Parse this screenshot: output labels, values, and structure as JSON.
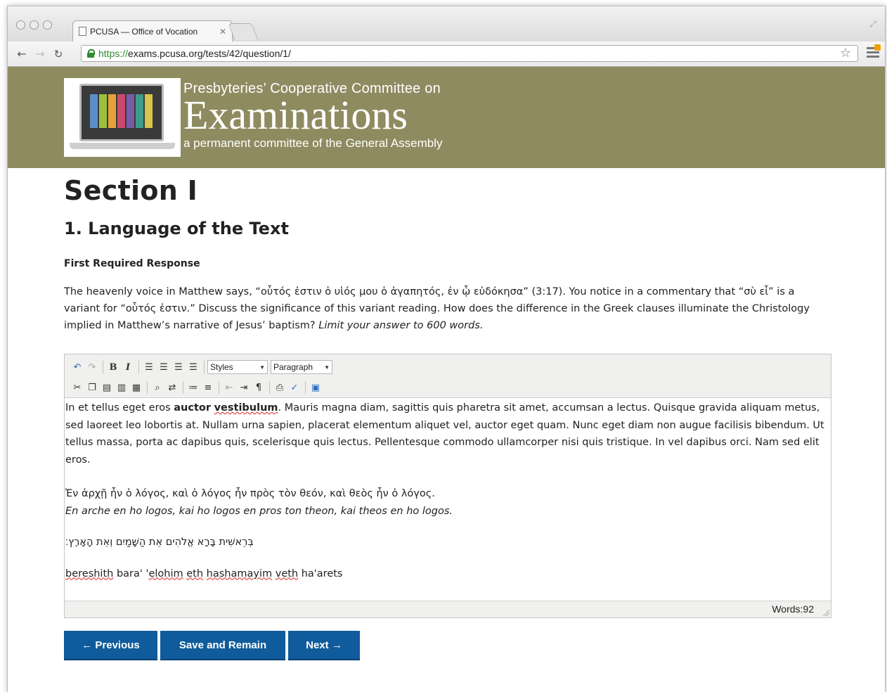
{
  "browser": {
    "tab_title": "PCUSA — Office of Vocation",
    "url_scheme": "https://",
    "url_rest": "exams.pcusa.org/tests/42/question/1/"
  },
  "banner": {
    "line1": "Presbyteries’ Cooperative Committee on",
    "title": "Examinations",
    "line3": "a permanent committee of the General Assembly",
    "color": "#8f8b60"
  },
  "section": {
    "heading": "Section I",
    "subheading": "1. Language of the Text",
    "required_label": "First Required Response",
    "prompt": "The heavenly voice in Matthew says, “οὗτός ἐστιν ὁ υἱός μου ὁ ἀγαπητός, ἐν ᾧ εὐδόκησα” (3:17). You notice in a commentary that “σὺ εἶ” is a variant for “οὗτός ἐστιν.” Discuss the significance of this variant reading. How does the difference in the Greek clauses illuminate the Christology implied in Matthew’s narrative of Jesus’ baptism? ",
    "prompt_limit": "Limit your answer to 600 words."
  },
  "editor": {
    "styles_select": "Styles",
    "format_select": "Paragraph",
    "para1_start": "In et tellus eget eros ",
    "para1_bold1": "auctor",
    "para1_bold2": "vestibulum",
    "para1_rest": ". Mauris magna diam, sagittis quis pharetra sit amet, accumsan a lectus. Quisque gravida aliquam metus, sed laoreet leo lobortis at. Nullam urna sapien, placerat elementum aliquet vel, auctor eget quam. Nunc eget diam non augue facilisis bibendum. Ut tellus massa, porta ac dapibus quis, scelerisque quis lectus. Pellentesque commodo ullamcorper nisi quis tristique. In vel dapibus orci. Nam sed elit eros.",
    "greek_line": "Ἐν ἀρχῇ ἦν ὁ λόγος, καὶ ὁ λόγος ἦν πρὸς τὸν θεόν, καὶ θεὸς ἦν ὁ λόγος.",
    "greek_translit": "En arche en ho logos, kai ho logos en pros ton theon, kai theos en ho logos.",
    "hebrew_line": "בְּרֵאשִׁית בָּרָא אֱלֹהִים אֵת הַשָּׁמַיִם וְאֵת הָאָרֶץ׃",
    "hebrew_w1": "bereshith",
    "hebrew_w2": " bara' '",
    "hebrew_w3": "elohim",
    "hebrew_w4": "eth",
    "hebrew_w5": "hashamayim",
    "hebrew_w6": "veth",
    "hebrew_w7": " ha'arets",
    "word_count": "Words:92"
  },
  "buttons": {
    "previous": "← Previous",
    "save": "Save and Remain",
    "next": "Next →"
  },
  "colors": {
    "button": "#0f5b9b",
    "banner": "#8f8b60"
  }
}
